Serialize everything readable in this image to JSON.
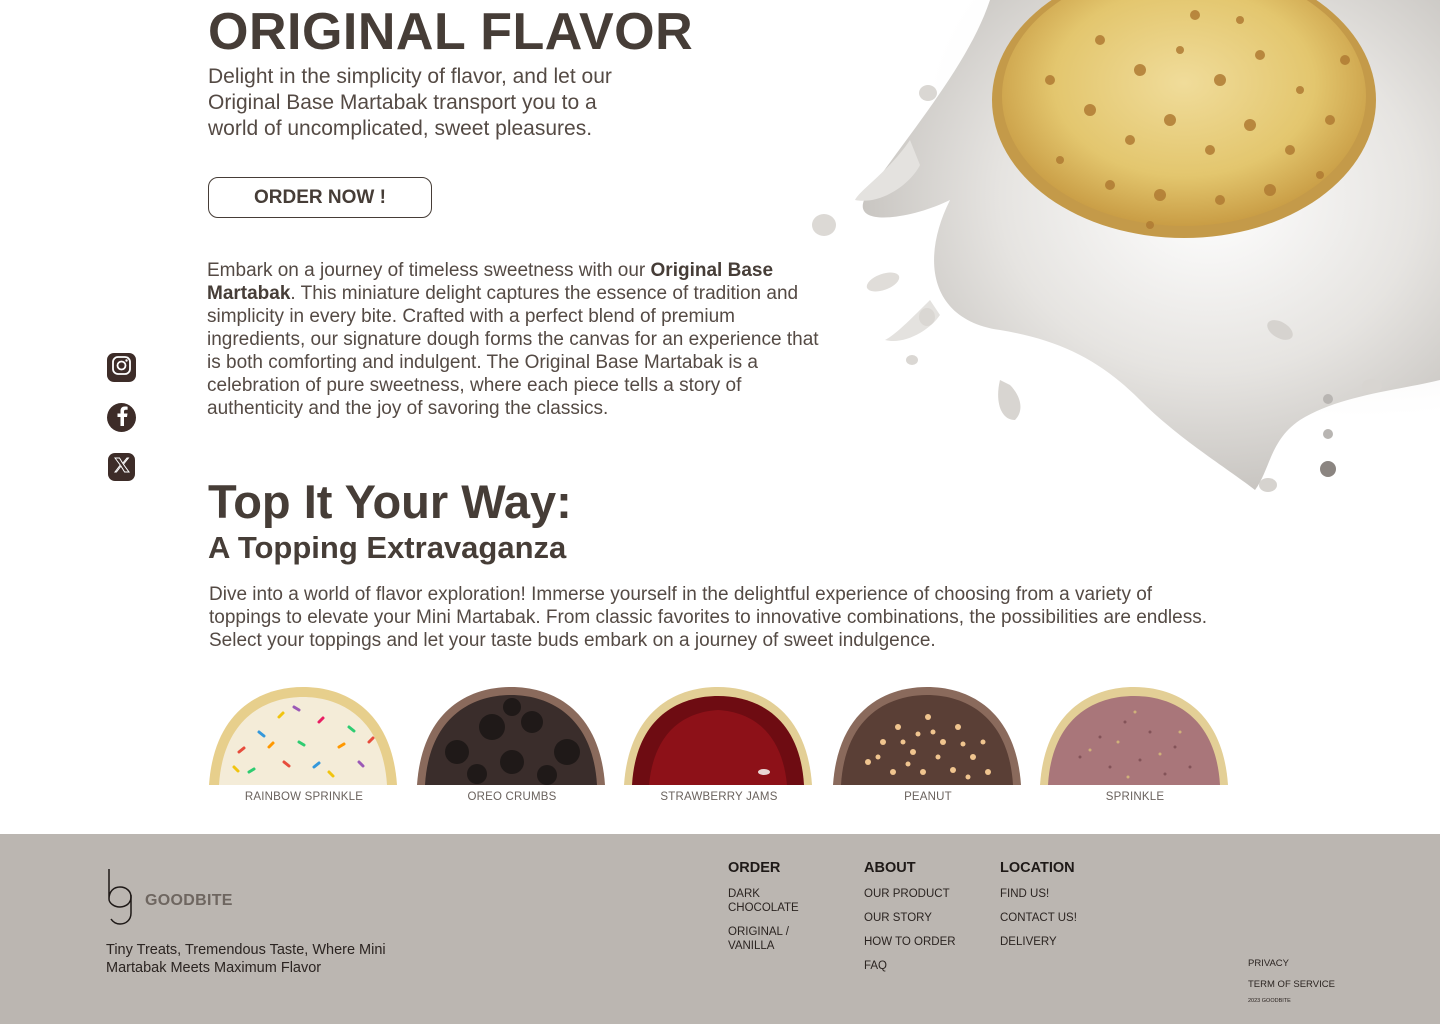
{
  "hero": {
    "title": "ORIGINAL FLAVOR",
    "description": "Delight in the simplicity of flavor, and let our Original Base Martabak transport you to a world of uncomplicated, sweet pleasures.",
    "cta": "ORDER NOW !"
  },
  "story": {
    "lead": "Embark on a journey of timeless sweetness with our ",
    "highlight": "Original Base Martabak",
    "body": ". This miniature delight captures the essence of tradition and simplicity in every bite. Crafted with a perfect blend of premium ingredients, our signature dough forms the canvas for an experience that is both comforting and indulgent. The Original Base Martabak is a celebration of pure sweetness, where each piece tells a story of authenticity and the joy of savoring the classics."
  },
  "social": [
    {
      "name": "instagram",
      "icon": "instagram-icon"
    },
    {
      "name": "facebook",
      "icon": "facebook-icon"
    },
    {
      "name": "x",
      "icon": "x-icon"
    }
  ],
  "carousel": {
    "slides": 3,
    "active": 3
  },
  "toppings_section": {
    "heading": "Top It Your Way:",
    "subheading": "A Topping Extravaganza",
    "intro": "Dive into a world of flavor exploration! Immerse yourself in the delightful experience of choosing from a variety of toppings to elevate your Mini Martabak. From classic favorites to innovative combinations, the possibilities are endless. Select your toppings and let your taste buds embark on a journey of sweet indulgence.",
    "items": [
      {
        "label": "RAINBOW SPRINKLE"
      },
      {
        "label": "OREO CRUMBS"
      },
      {
        "label": "STRAWBERRY JAMS"
      },
      {
        "label": "PEANUT"
      },
      {
        "label": "SPRINKLE"
      }
    ]
  },
  "footer": {
    "brand": "GOODBITE",
    "tagline": "Tiny Treats, Tremendous Taste, Where Mini Martabak Meets Maximum Flavor",
    "columns": [
      {
        "title": "ORDER",
        "links": [
          "DARK CHOCOLATE",
          "ORIGINAL / VANILLA"
        ]
      },
      {
        "title": "ABOUT",
        "links": [
          "OUR PRODUCT",
          "OUR STORY",
          "HOW TO ORDER",
          "FAQ"
        ]
      },
      {
        "title": "LOCATION",
        "links": [
          "FIND US!",
          "CONTACT US!",
          "DELIVERY"
        ]
      }
    ],
    "legal": [
      "PRIVACY",
      "TERM OF SERVICE"
    ],
    "copyright": "2023 GOODBITE"
  },
  "colors": {
    "text": "#463d37",
    "footer_bg": "#bbb6b1",
    "social_bg": "#3d2c28"
  }
}
